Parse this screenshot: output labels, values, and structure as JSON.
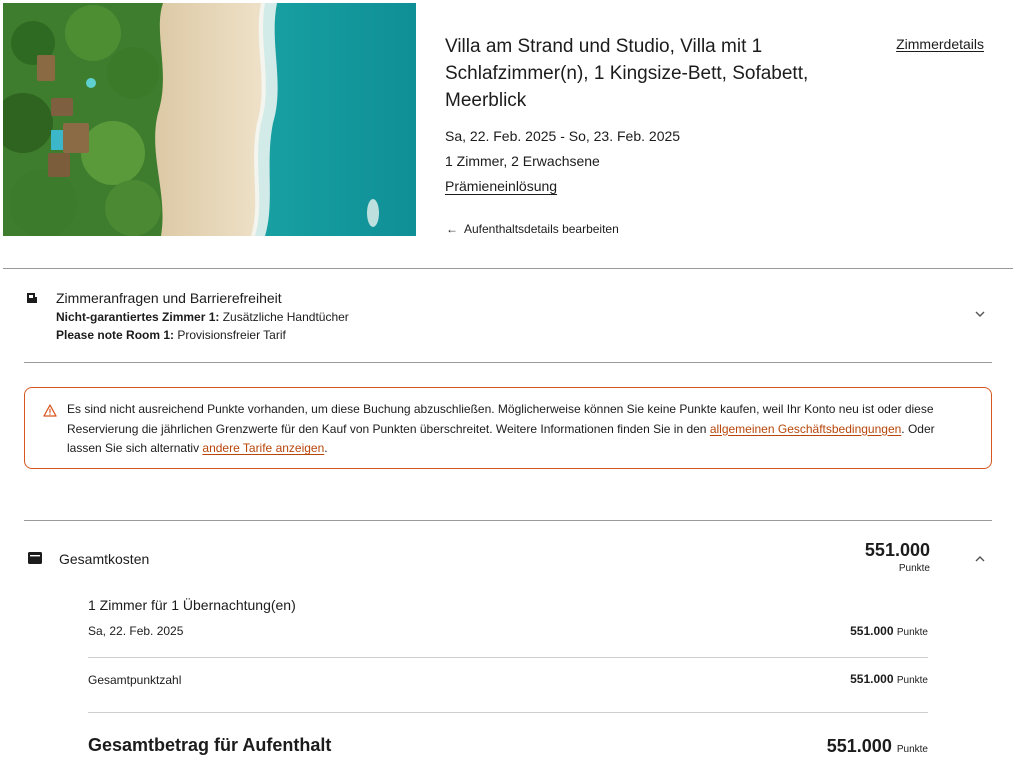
{
  "room": {
    "title": "Villa am Strand und Studio, Villa mit 1 Schlafzimmer(n), 1 Kingsize-Bett, Sofabett, Meerblick",
    "details_link": "Zimmerdetails",
    "dates": "Sa, 22. Feb. 2025 - So, 23. Feb. 2025",
    "guests": "1 Zimmer, 2 Erwachsene",
    "rate_type": "Prämieneinlösung",
    "edit_link": "Aufenthaltsdetails bearbeiten",
    "image_alt_icon": "beach-villa-aerial-photo"
  },
  "requests": {
    "title": "Zimmeranfragen und Barrierefreiheit",
    "line1_label": "Nicht-garantiertes Zimmer 1:",
    "line1_value": " Zusätzliche Handtücher",
    "line2_label": "Please note Room 1:",
    "line2_value": " Provisionsfreier Tarif",
    "icon": "accessibility-room-icon"
  },
  "alert": {
    "text_part1": "Es sind nicht ausreichend Punkte vorhanden, um diese Buchung abzuschließen. Möglicherweise können Sie keine Punkte kaufen, weil Ihr Konto neu ist oder diese Reservierung die jährlichen Grenzwerte für den Kauf von Punkten überschreitet.  Weitere Informationen finden Sie in den ",
    "terms_link": "allgemeinen Geschäftsbedingungen",
    "text_part2": ". Oder lassen Sie sich alternativ ",
    "other_rates_link": "andere Tarife anzeigen",
    "text_part3": ".",
    "color": "#d9571f",
    "icon": "warning-icon"
  },
  "cost": {
    "label": "Gesamtkosten",
    "amount": "551.000",
    "unit": "Punkte",
    "icon": "wallet-icon",
    "nights_title": "1 Zimmer für 1 Übernachtung(en)",
    "night_date": "Sa, 22. Feb. 2025",
    "night_price": "551.000",
    "night_unit": "Punkte",
    "total_points_label": "Gesamtpunktzahl",
    "total_points_value": "551.000",
    "total_points_unit": "Punkte",
    "grand_label": "Gesamtbetrag für Aufenthalt",
    "grand_value": "551.000",
    "grand_unit": "Punkte"
  }
}
